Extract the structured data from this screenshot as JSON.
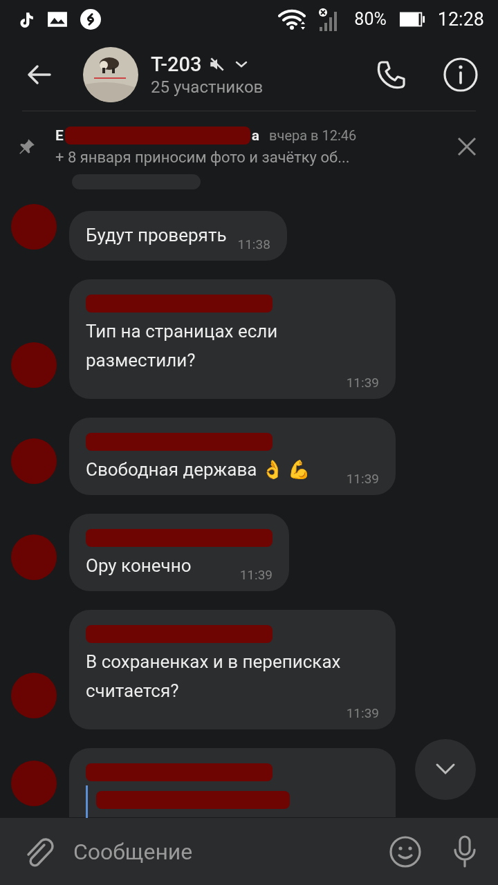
{
  "status_bar": {
    "battery": "80%",
    "time": "12:28"
  },
  "header": {
    "title": "Т-203",
    "muted": true,
    "subtitle": "25 участников"
  },
  "pinned": {
    "author_start": "Е",
    "author_end": "а",
    "time": "вчера в 12:46",
    "text": "+ 8 января приносим фото и зачётку об..."
  },
  "messages": [
    {
      "kind": "partial"
    },
    {
      "kind": "text",
      "sender_redacted": false,
      "text": "Будут проверять",
      "time": "11:38"
    },
    {
      "kind": "text",
      "sender_redacted": true,
      "text": "Тип на страницах если разместили?",
      "time": "11:39",
      "wide": true
    },
    {
      "kind": "text",
      "sender_redacted": true,
      "text": "Свободная держава 👌 💪",
      "time": "11:39",
      "wide": true
    },
    {
      "kind": "text",
      "sender_redacted": true,
      "text": "Ору конечно",
      "time": "11:39"
    },
    {
      "kind": "text",
      "sender_redacted": true,
      "text": "В сохраненках и в переписках считается?",
      "time": "11:39",
      "wide": true
    },
    {
      "kind": "reply",
      "sender_redacted": true
    }
  ],
  "composer": {
    "placeholder": "Сообщение"
  }
}
